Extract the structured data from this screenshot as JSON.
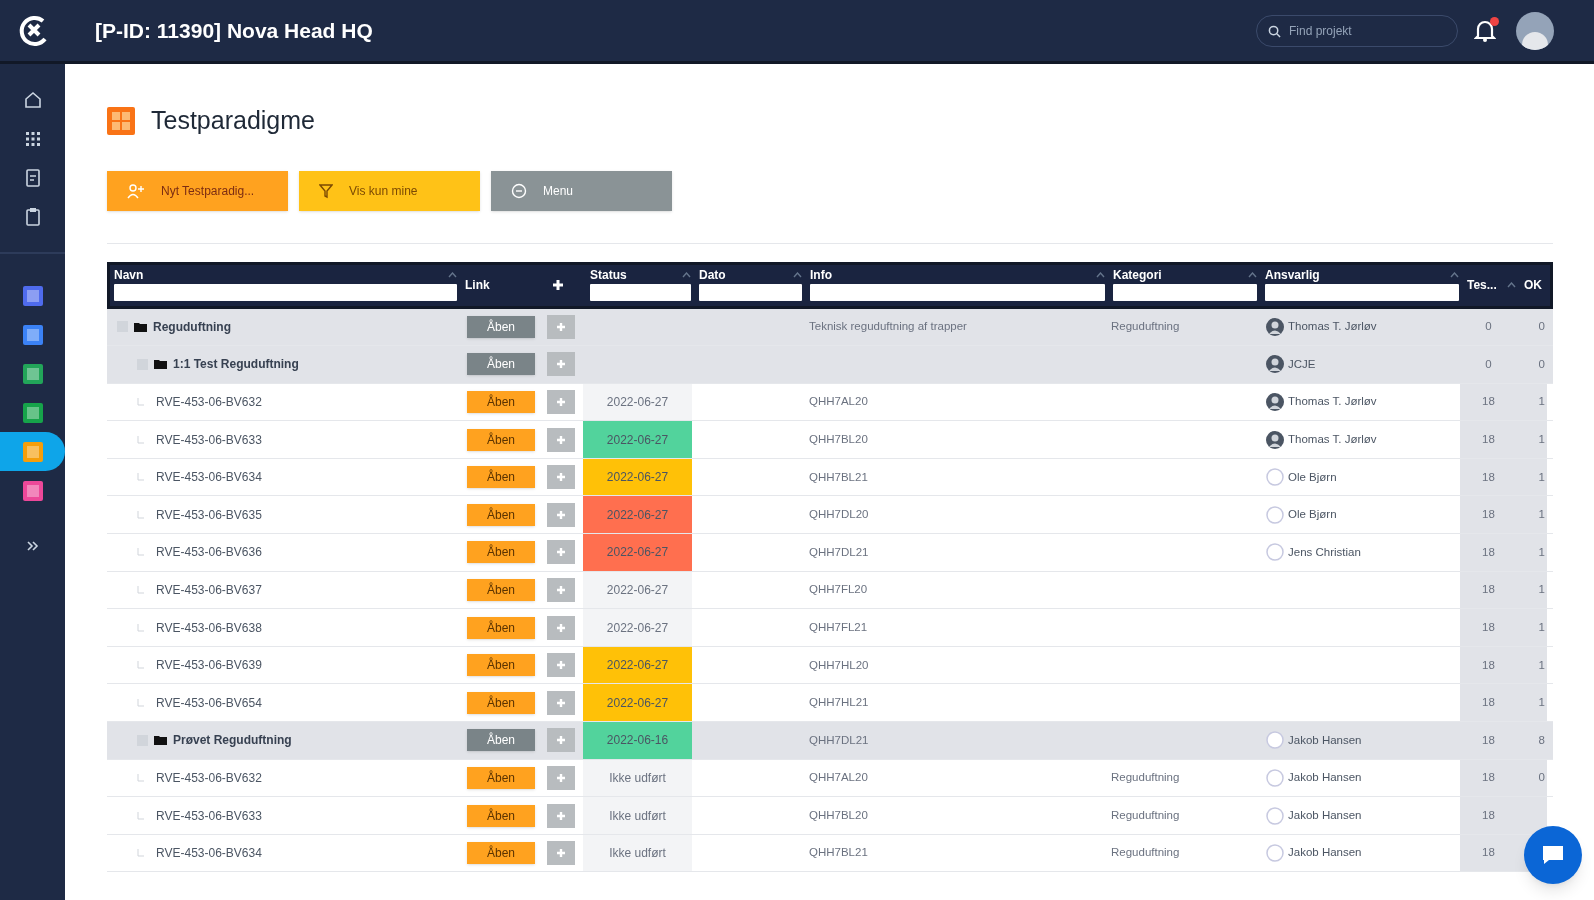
{
  "topbar": {
    "title": "[P-ID: 11390] Nova Head HQ",
    "search": {
      "placeholder": "Find projekt"
    },
    "notification": true
  },
  "sidebar": {
    "items": [
      {
        "kind": "home",
        "selected": false
      },
      {
        "kind": "grid",
        "selected": false
      },
      {
        "kind": "doc",
        "selected": false
      },
      {
        "kind": "clipboard",
        "selected": false
      },
      {
        "kind": "app",
        "color": "#4f6bed",
        "selected": false
      },
      {
        "kind": "app",
        "color": "#3b82f6",
        "selected": false
      },
      {
        "kind": "app",
        "color": "#22a559",
        "selected": false
      },
      {
        "kind": "app",
        "color": "#16a34a",
        "selected": false
      },
      {
        "kind": "app",
        "color": "#f59e0b",
        "selected": true
      },
      {
        "kind": "app",
        "color": "#ec4899",
        "selected": false
      },
      {
        "kind": "expand",
        "selected": false
      }
    ]
  },
  "page": {
    "title": "Testparadigme",
    "buttons": [
      {
        "kind": "new",
        "label": "Nyt Testparadig..."
      },
      {
        "kind": "filter",
        "label": "Vis kun mine"
      },
      {
        "kind": "menu",
        "label": "Menu"
      }
    ]
  },
  "table": {
    "columns": [
      {
        "label": "Navn",
        "filter": true
      },
      {
        "label": "Link",
        "filter": false
      },
      {
        "label": "Status",
        "filter": true
      },
      {
        "label": "Dato",
        "filter": true
      },
      {
        "label": "Info",
        "filter": true
      },
      {
        "label": "Kategori",
        "filter": true
      },
      {
        "label": "Ansvarlig",
        "filter": true
      },
      {
        "label": "Tes...",
        "filter": false
      },
      {
        "label": "OK",
        "filter": false
      }
    ],
    "rows": [
      {
        "kind": "group",
        "name": "Reguduftning",
        "link": "Åben",
        "info": "Teknisk reguduftning af trapper",
        "category": "Reguduftning",
        "owner": "Thomas T. Jørløv",
        "avatar_photo": true,
        "tests": "0",
        "ok": "0",
        "children": [
          {
            "kind": "group",
            "name": "1:1 Test Reguduftning",
            "link": "Åben",
            "owner": "JCJE",
            "avatar_photo": true,
            "tests": "0",
            "ok": "0",
            "children": [
              {
                "kind": "item",
                "name": "RVE-453-06-BV632",
                "link": "Åben",
                "status": "2022-06-27",
                "info": "QHH7AL20",
                "owner": "Thomas T. Jørløv",
                "avatar_photo": true,
                "tests": "18",
                "ok": "1"
              },
              {
                "kind": "item",
                "name": "RVE-453-06-BV633",
                "link": "Åben",
                "status": "2022-06-27",
                "color": "#52d39c",
                "info": "QHH7BL20",
                "owner": "Thomas T. Jørløv",
                "avatar_photo": true,
                "tests": "18",
                "ok": "1"
              },
              {
                "kind": "item",
                "name": "RVE-453-06-BV634",
                "link": "Åben",
                "status": "2022-06-27",
                "color": "#ffc107",
                "info": "QHH7BL21",
                "owner": "Ole Bjørn",
                "avatar_photo": false,
                "tests": "18",
                "ok": "1"
              },
              {
                "kind": "item",
                "name": "RVE-453-06-BV635",
                "link": "Åben",
                "status": "2022-06-27",
                "color": "#ff6f4f",
                "info": "QHH7DL20",
                "owner": "Ole Bjørn",
                "avatar_photo": false,
                "tests": "18",
                "ok": "1"
              },
              {
                "kind": "item",
                "name": "RVE-453-06-BV636",
                "link": "Åben",
                "status": "2022-06-27",
                "color": "#ff6f4f",
                "info": "QHH7DL21",
                "owner": "Jens Christian",
                "avatar_photo": false,
                "tests": "18",
                "ok": "1"
              },
              {
                "kind": "item",
                "name": "RVE-453-06-BV637",
                "link": "Åben",
                "status": "2022-06-27",
                "info": "QHH7FL20",
                "tests": "18",
                "ok": "1"
              },
              {
                "kind": "item",
                "name": "RVE-453-06-BV638",
                "link": "Åben",
                "status": "2022-06-27",
                "info": "QHH7FL21",
                "tests": "18",
                "ok": "1"
              },
              {
                "kind": "item",
                "name": "RVE-453-06-BV639",
                "link": "Åben",
                "status": "2022-06-27",
                "color": "#ffc107",
                "info": "QHH7HL20",
                "tests": "18",
                "ok": "1"
              },
              {
                "kind": "item",
                "name": "RVE-453-06-BV654",
                "link": "Åben",
                "status": "2022-06-27",
                "color": "#ffc107",
                "info": "QHH7HL21",
                "tests": "18",
                "ok": "1"
              }
            ]
          },
          {
            "kind": "group",
            "name": "Prøvet Reguduftning",
            "link": "Åben",
            "status": "2022-06-16",
            "color": "#52d39c",
            "info": "QHH7DL21",
            "owner": "Jakob Hansen",
            "avatar_photo": false,
            "tests": "18",
            "ok": "8",
            "children": [
              {
                "kind": "item",
                "name": "RVE-453-06-BV632",
                "link": "Åben",
                "status": "Ikke udført",
                "info": "QHH7AL20",
                "category": "Reguduftning",
                "owner": "Jakob Hansen",
                "avatar_photo": false,
                "tests": "18",
                "ok": "0"
              },
              {
                "kind": "item",
                "name": "RVE-453-06-BV633",
                "link": "Åben",
                "status": "Ikke udført",
                "info": "QHH7BL20",
                "category": "Reguduftning",
                "owner": "Jakob Hansen",
                "avatar_photo": false,
                "tests": "18"
              },
              {
                "kind": "item",
                "name": "RVE-453-06-BV634",
                "link": "Åben",
                "status": "Ikke udført",
                "info": "QHH7BL21",
                "category": "Reguduftning",
                "owner": "Jakob Hansen",
                "avatar_photo": false,
                "tests": "18"
              }
            ]
          }
        ]
      }
    ]
  }
}
